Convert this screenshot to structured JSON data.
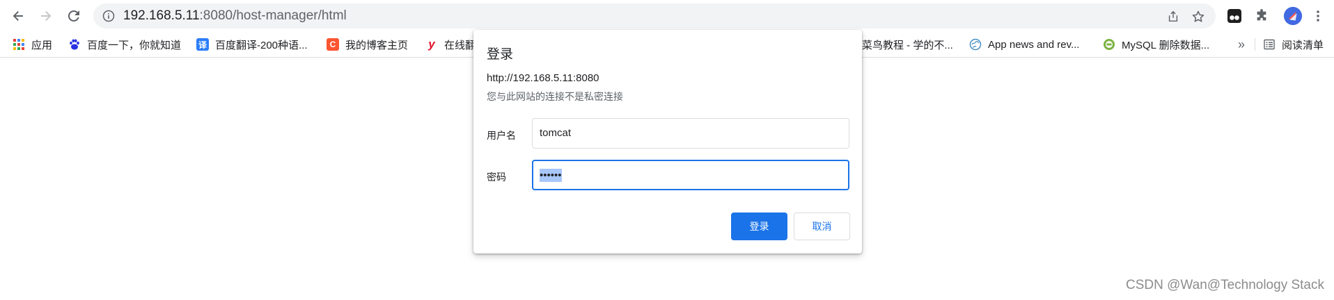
{
  "toolbar": {
    "url_host": "192.168.5.11",
    "url_rest": ":8080/host-manager/html"
  },
  "bookmarks": {
    "apps": "应用",
    "items": [
      "百度一下，你就知道",
      "百度翻译-200种语...",
      "我的博客主页",
      "在线翻",
      "菜鸟教程 - 学的不...",
      "App news and rev...",
      "MySQL 删除数据..."
    ],
    "overflow": "»",
    "reading_list": "阅读清单",
    "favicon_letters": {
      "fanyi": "译",
      "blog": "C",
      "youdao": "y"
    }
  },
  "dialog": {
    "title": "登录",
    "origin": "http://192.168.5.11:8080",
    "warning": "您与此网站的连接不是私密连接",
    "username_label": "用户名",
    "username_value": "tomcat",
    "password_label": "密码",
    "password_value": "••••••",
    "login_button": "登录",
    "cancel_button": "取消"
  },
  "watermark": "CSDN @Wan@Technology Stack",
  "colors": {
    "accent": "#1a73e8",
    "selection": "#a8c7fa",
    "omnibox_bg": "#f1f3f4"
  }
}
